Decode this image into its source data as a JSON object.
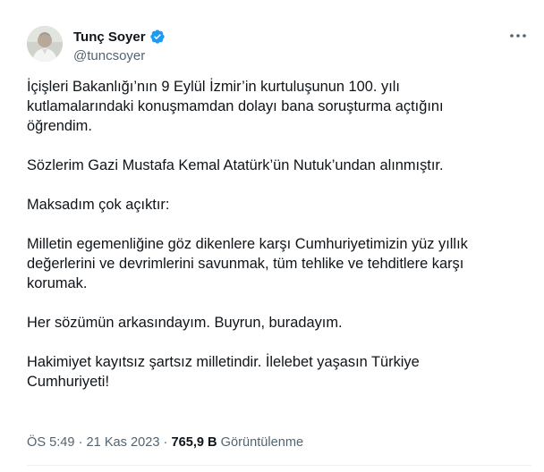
{
  "author": {
    "display_name": "Tunç Soyer",
    "handle": "@tuncsoyer",
    "verified_icon": "verified-badge-icon",
    "verified_color": "#1d9bf0"
  },
  "more_icon": "more-horizontal-icon",
  "tweet": {
    "paragraphs": [
      "İçişleri Bakanlığı’nın 9 Eylül İzmir’in kurtuluşunun 100. yılı\nkutlamalarındaki konuşmamdan dolayı bana soruşturma açtığını\nöğrendim.",
      "Sözlerim Gazi Mustafa Kemal Atatürk’ün Nutuk’undan alınmıştır.",
      "Maksadım çok açıktır:",
      "Milletin egemenliğine göz dikenlere karşı Cumhuriyetimizin yüz yıllık\ndeğerlerini ve devrimlerini savunmak, tüm tehlike ve tehditlere karşı\nkorumak.",
      "Her sözümün arkasındayım. Buyrun, buradayım.",
      "Hakimiyet kayıtsız şartsız milletindir. İlelebet yaşasın Türkiye\nCumhuriyeti!"
    ]
  },
  "meta": {
    "time": "ÖS 5:49",
    "separator": " · ",
    "date": "21 Kas 2023",
    "views_count": "765,9 B",
    "views_label": "Görüntülenme"
  }
}
